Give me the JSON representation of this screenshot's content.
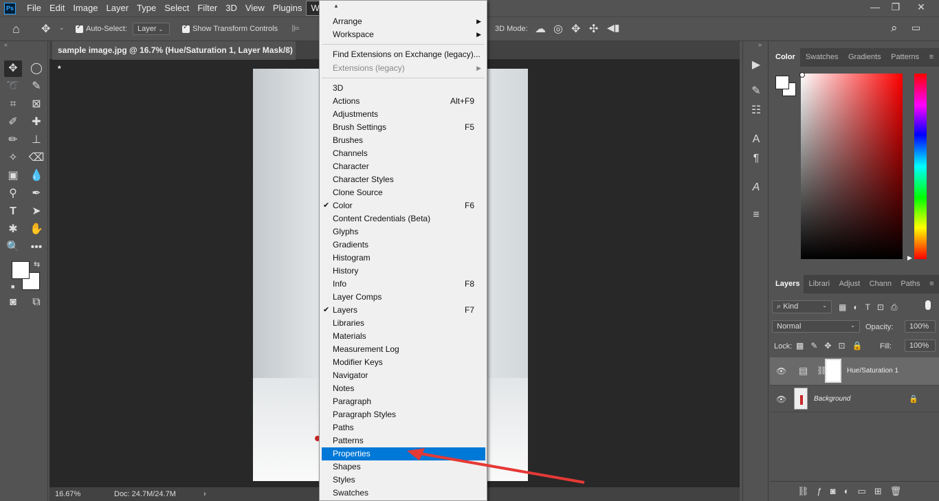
{
  "menubar": {
    "logo": "Ps",
    "items": [
      "File",
      "Edit",
      "Image",
      "Layer",
      "Type",
      "Select",
      "Filter",
      "3D",
      "View",
      "Plugins",
      "Window"
    ]
  },
  "options": {
    "auto_select_label": "Auto-Select:",
    "auto_select_value": "Layer",
    "transform_label": "Show Transform Controls",
    "mode_3d_label": "3D Mode:"
  },
  "document": {
    "tab_title": "sample image.jpg @ 16.7% (Hue/Saturation 1, Layer Mask/8) *",
    "zoom": "16.67%",
    "doc_size": "Doc: 24.7M/24.7M"
  },
  "color_panel": {
    "tabs": [
      "Color",
      "Swatches",
      "Gradients",
      "Patterns"
    ]
  },
  "layers_panel": {
    "tabs": [
      "Layers",
      "Librari",
      "Adjust",
      "Chann",
      "Paths"
    ],
    "kind_label": "Kind",
    "blend_mode": "Normal",
    "opacity_label": "Opacity:",
    "opacity_value": "100%",
    "lock_label": "Lock:",
    "fill_label": "Fill:",
    "fill_value": "100%",
    "layers": [
      {
        "name": "Hue/Saturation 1"
      },
      {
        "name": "Background"
      }
    ]
  },
  "window_menu": {
    "top_items": [
      "Arrange",
      "Workspace"
    ],
    "ext_items": [
      "Find Extensions on Exchange (legacy)...",
      "Extensions (legacy)"
    ],
    "items": [
      {
        "label": "3D",
        "shortcut": "",
        "checked": false
      },
      {
        "label": "Actions",
        "shortcut": "Alt+F9",
        "checked": false
      },
      {
        "label": "Adjustments",
        "shortcut": "",
        "checked": false
      },
      {
        "label": "Brush Settings",
        "shortcut": "F5",
        "checked": false
      },
      {
        "label": "Brushes",
        "shortcut": "",
        "checked": false
      },
      {
        "label": "Channels",
        "shortcut": "",
        "checked": false
      },
      {
        "label": "Character",
        "shortcut": "",
        "checked": false
      },
      {
        "label": "Character Styles",
        "shortcut": "",
        "checked": false
      },
      {
        "label": "Clone Source",
        "shortcut": "",
        "checked": false
      },
      {
        "label": "Color",
        "shortcut": "F6",
        "checked": true
      },
      {
        "label": "Content Credentials (Beta)",
        "shortcut": "",
        "checked": false
      },
      {
        "label": "Glyphs",
        "shortcut": "",
        "checked": false
      },
      {
        "label": "Gradients",
        "shortcut": "",
        "checked": false
      },
      {
        "label": "Histogram",
        "shortcut": "",
        "checked": false
      },
      {
        "label": "History",
        "shortcut": "",
        "checked": false
      },
      {
        "label": "Info",
        "shortcut": "F8",
        "checked": false
      },
      {
        "label": "Layer Comps",
        "shortcut": "",
        "checked": false
      },
      {
        "label": "Layers",
        "shortcut": "F7",
        "checked": true
      },
      {
        "label": "Libraries",
        "shortcut": "",
        "checked": false
      },
      {
        "label": "Materials",
        "shortcut": "",
        "checked": false
      },
      {
        "label": "Measurement Log",
        "shortcut": "",
        "checked": false
      },
      {
        "label": "Modifier Keys",
        "shortcut": "",
        "checked": false
      },
      {
        "label": "Navigator",
        "shortcut": "",
        "checked": false
      },
      {
        "label": "Notes",
        "shortcut": "",
        "checked": false
      },
      {
        "label": "Paragraph",
        "shortcut": "",
        "checked": false
      },
      {
        "label": "Paragraph Styles",
        "shortcut": "",
        "checked": false
      },
      {
        "label": "Paths",
        "shortcut": "",
        "checked": false
      },
      {
        "label": "Patterns",
        "shortcut": "",
        "checked": false
      },
      {
        "label": "Properties",
        "shortcut": "",
        "checked": false,
        "highlighted": true
      },
      {
        "label": "Shapes",
        "shortcut": "",
        "checked": false
      },
      {
        "label": "Styles",
        "shortcut": "",
        "checked": false
      },
      {
        "label": "Swatches",
        "shortcut": "",
        "checked": false
      }
    ]
  },
  "colors": {
    "highlight": "#0078d7",
    "arrow": "#e53935"
  }
}
